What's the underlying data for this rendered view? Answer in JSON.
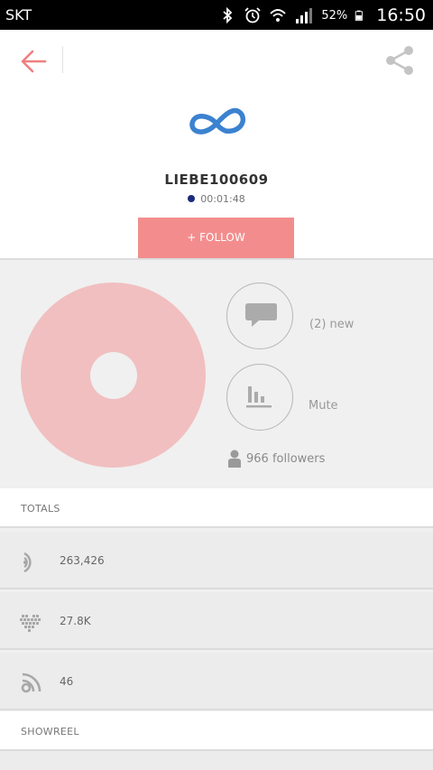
{
  "status_bar": {
    "carrier": "SKT",
    "battery": "52%",
    "time": "16:50"
  },
  "header": {
    "username": "LIEBE100609",
    "timer": "00:01:48",
    "colors": {
      "accent": "#f38d8d",
      "logo": "#3b82d0",
      "status_dot": "#1c2a7a"
    }
  },
  "follow_button": {
    "label": "+ FOLLOW"
  },
  "profile": {
    "messages_label": "(2) new",
    "mute_label": "Mute",
    "followers_text": "966 followers",
    "donut_color": "#f1bfc0"
  },
  "totals": {
    "title": "TOTALS",
    "rows": [
      {
        "icon": "listens-icon",
        "value": "263,426"
      },
      {
        "icon": "heart-icon",
        "value": "27.8K"
      },
      {
        "icon": "podcast-icon",
        "value": "46"
      }
    ]
  },
  "showreel": {
    "title": "SHOWREEL"
  }
}
